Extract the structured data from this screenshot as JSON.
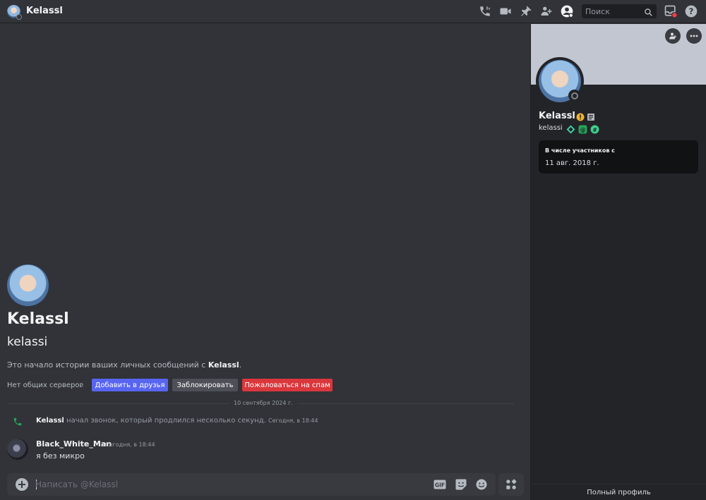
{
  "header": {
    "title": "Kelassl",
    "search_placeholder": "Поиск",
    "icons": [
      "voice-call-icon",
      "video-call-icon",
      "pinned-icon",
      "add-friends-to-dm-icon",
      "user-profile-icon",
      "search-icon",
      "inbox-icon",
      "help-icon"
    ]
  },
  "profile_intro": {
    "display_name": "Kelassl",
    "username": "kelassi",
    "intro_prefix": "Это начало истории ваших личных сообщений с ",
    "intro_name": "Kelassl",
    "intro_suffix": ".",
    "no_mutual_servers": "Нет общих серверов",
    "add_friend_label": "Добавить в друзья",
    "block_label": "Заблокировать",
    "report_spam_label": "Пожаловаться на спам"
  },
  "messages": {
    "date_divider": "10 сентября 2024 г.",
    "call_event": {
      "author": "Kelassl",
      "text": " начал звонок, который продлился несколько секунд. ",
      "time": "Сегодня, в 18:44"
    },
    "message": {
      "author": "Black_White_Man",
      "time": "Сегодня, в 18:44",
      "text": "я без микро"
    }
  },
  "composer": {
    "placeholder": "Написать @Kelassl",
    "gif_label": "GIF"
  },
  "side_panel": {
    "display_name": "Kelassl",
    "username": "kelassi",
    "member_since_label": "В числе участников с",
    "member_since_date": "11 авг. 2018 г.",
    "full_profile_label": "Полный профиль"
  },
  "colors": {
    "accent": "#5865f2",
    "danger": "#da373c",
    "call_green": "#23a55a",
    "banner": "#c1c6d0"
  }
}
